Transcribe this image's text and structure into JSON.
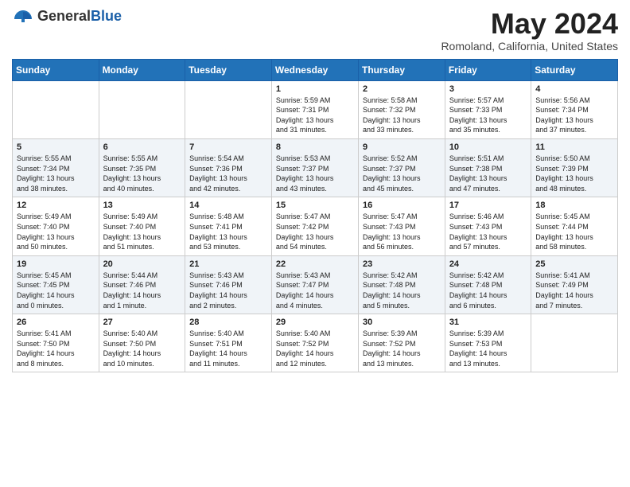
{
  "logo": {
    "general": "General",
    "blue": "Blue"
  },
  "title": "May 2024",
  "location": "Romoland, California, United States",
  "days_of_week": [
    "Sunday",
    "Monday",
    "Tuesday",
    "Wednesday",
    "Thursday",
    "Friday",
    "Saturday"
  ],
  "weeks": [
    [
      {
        "day": "",
        "info": ""
      },
      {
        "day": "",
        "info": ""
      },
      {
        "day": "",
        "info": ""
      },
      {
        "day": "1",
        "info": "Sunrise: 5:59 AM\nSunset: 7:31 PM\nDaylight: 13 hours\nand 31 minutes."
      },
      {
        "day": "2",
        "info": "Sunrise: 5:58 AM\nSunset: 7:32 PM\nDaylight: 13 hours\nand 33 minutes."
      },
      {
        "day": "3",
        "info": "Sunrise: 5:57 AM\nSunset: 7:33 PM\nDaylight: 13 hours\nand 35 minutes."
      },
      {
        "day": "4",
        "info": "Sunrise: 5:56 AM\nSunset: 7:34 PM\nDaylight: 13 hours\nand 37 minutes."
      }
    ],
    [
      {
        "day": "5",
        "info": "Sunrise: 5:55 AM\nSunset: 7:34 PM\nDaylight: 13 hours\nand 38 minutes."
      },
      {
        "day": "6",
        "info": "Sunrise: 5:55 AM\nSunset: 7:35 PM\nDaylight: 13 hours\nand 40 minutes."
      },
      {
        "day": "7",
        "info": "Sunrise: 5:54 AM\nSunset: 7:36 PM\nDaylight: 13 hours\nand 42 minutes."
      },
      {
        "day": "8",
        "info": "Sunrise: 5:53 AM\nSunset: 7:37 PM\nDaylight: 13 hours\nand 43 minutes."
      },
      {
        "day": "9",
        "info": "Sunrise: 5:52 AM\nSunset: 7:37 PM\nDaylight: 13 hours\nand 45 minutes."
      },
      {
        "day": "10",
        "info": "Sunrise: 5:51 AM\nSunset: 7:38 PM\nDaylight: 13 hours\nand 47 minutes."
      },
      {
        "day": "11",
        "info": "Sunrise: 5:50 AM\nSunset: 7:39 PM\nDaylight: 13 hours\nand 48 minutes."
      }
    ],
    [
      {
        "day": "12",
        "info": "Sunrise: 5:49 AM\nSunset: 7:40 PM\nDaylight: 13 hours\nand 50 minutes."
      },
      {
        "day": "13",
        "info": "Sunrise: 5:49 AM\nSunset: 7:40 PM\nDaylight: 13 hours\nand 51 minutes."
      },
      {
        "day": "14",
        "info": "Sunrise: 5:48 AM\nSunset: 7:41 PM\nDaylight: 13 hours\nand 53 minutes."
      },
      {
        "day": "15",
        "info": "Sunrise: 5:47 AM\nSunset: 7:42 PM\nDaylight: 13 hours\nand 54 minutes."
      },
      {
        "day": "16",
        "info": "Sunrise: 5:47 AM\nSunset: 7:43 PM\nDaylight: 13 hours\nand 56 minutes."
      },
      {
        "day": "17",
        "info": "Sunrise: 5:46 AM\nSunset: 7:43 PM\nDaylight: 13 hours\nand 57 minutes."
      },
      {
        "day": "18",
        "info": "Sunrise: 5:45 AM\nSunset: 7:44 PM\nDaylight: 13 hours\nand 58 minutes."
      }
    ],
    [
      {
        "day": "19",
        "info": "Sunrise: 5:45 AM\nSunset: 7:45 PM\nDaylight: 14 hours\nand 0 minutes."
      },
      {
        "day": "20",
        "info": "Sunrise: 5:44 AM\nSunset: 7:46 PM\nDaylight: 14 hours\nand 1 minute."
      },
      {
        "day": "21",
        "info": "Sunrise: 5:43 AM\nSunset: 7:46 PM\nDaylight: 14 hours\nand 2 minutes."
      },
      {
        "day": "22",
        "info": "Sunrise: 5:43 AM\nSunset: 7:47 PM\nDaylight: 14 hours\nand 4 minutes."
      },
      {
        "day": "23",
        "info": "Sunrise: 5:42 AM\nSunset: 7:48 PM\nDaylight: 14 hours\nand 5 minutes."
      },
      {
        "day": "24",
        "info": "Sunrise: 5:42 AM\nSunset: 7:48 PM\nDaylight: 14 hours\nand 6 minutes."
      },
      {
        "day": "25",
        "info": "Sunrise: 5:41 AM\nSunset: 7:49 PM\nDaylight: 14 hours\nand 7 minutes."
      }
    ],
    [
      {
        "day": "26",
        "info": "Sunrise: 5:41 AM\nSunset: 7:50 PM\nDaylight: 14 hours\nand 8 minutes."
      },
      {
        "day": "27",
        "info": "Sunrise: 5:40 AM\nSunset: 7:50 PM\nDaylight: 14 hours\nand 10 minutes."
      },
      {
        "day": "28",
        "info": "Sunrise: 5:40 AM\nSunset: 7:51 PM\nDaylight: 14 hours\nand 11 minutes."
      },
      {
        "day": "29",
        "info": "Sunrise: 5:40 AM\nSunset: 7:52 PM\nDaylight: 14 hours\nand 12 minutes."
      },
      {
        "day": "30",
        "info": "Sunrise: 5:39 AM\nSunset: 7:52 PM\nDaylight: 14 hours\nand 13 minutes."
      },
      {
        "day": "31",
        "info": "Sunrise: 5:39 AM\nSunset: 7:53 PM\nDaylight: 14 hours\nand 13 minutes."
      },
      {
        "day": "",
        "info": ""
      }
    ]
  ]
}
